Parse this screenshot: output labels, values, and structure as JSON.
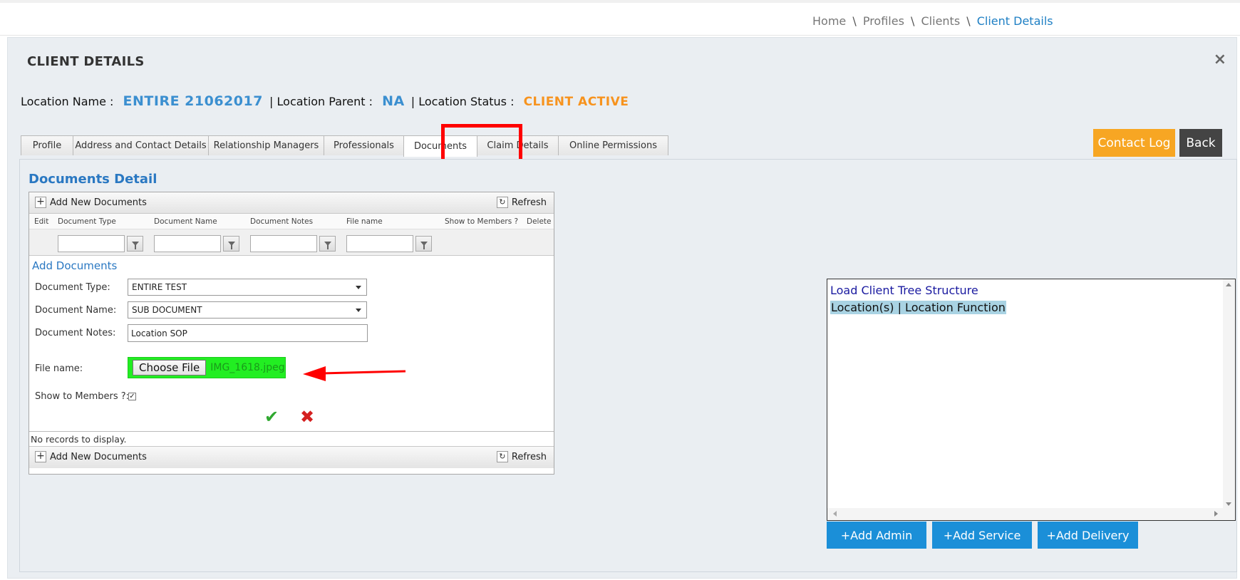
{
  "breadcrumb": {
    "home": "Home",
    "profiles": "Profiles",
    "clients": "Clients",
    "current": "Client Details",
    "separator": "\\"
  },
  "panel": {
    "title": "CLIENT DETAILS",
    "close_symbol": "×"
  },
  "location": {
    "name_label": "Location Name :",
    "name_value": "ENTIRE 21062017",
    "separator": "|",
    "parent_label": "Location Parent :",
    "parent_value": "NA",
    "status_label": "Location Status :",
    "status_value": "CLIENT ACTIVE"
  },
  "tabs": [
    {
      "label": "Profile"
    },
    {
      "label": "Address and Contact Details"
    },
    {
      "label": "Relationship Managers"
    },
    {
      "label": "Professionals"
    },
    {
      "label": "Documents",
      "active": true
    },
    {
      "label": "Claim Details"
    },
    {
      "label": "Online Permissions"
    }
  ],
  "actions": {
    "contact_log": "Contact Log",
    "back": "Back"
  },
  "documents": {
    "section_title": "Documents Detail",
    "toolbar": {
      "add_label": "Add New Documents",
      "add_symbol": "+",
      "refresh_label": "Refresh"
    },
    "columns": [
      "Edit",
      "Document Type",
      "Document Name",
      "Document Notes",
      "File name",
      "Show to Members ?",
      "Delete"
    ],
    "form": {
      "title": "Add Documents",
      "type_label": "Document Type:",
      "type_value": "ENTIRE TEST",
      "name_label": "Document Name:",
      "name_value": "SUB DOCUMENT",
      "notes_label": "Document Notes:",
      "notes_value": "Location SOP",
      "file_label": "File name:",
      "choose_file": "Choose File",
      "file_value": "IMG_1618.jpeg",
      "show_label": "Show to Members ?:",
      "show_checked": true
    },
    "no_records": "No records to display."
  },
  "tree": {
    "title": "Load Client Tree Structure",
    "item": "Location(s) | Location Function"
  },
  "tree_buttons": {
    "add_admin": "+Add Admin",
    "add_service": "+Add Service",
    "add_delivery": "+Add Delivery"
  },
  "colors": {
    "accent_blue": "#2a78c2",
    "status_orange": "#f7931e",
    "contact_log_bg": "#f7a623",
    "back_bg": "#444444",
    "file_highlight": "#22ee22",
    "annotation_red": "#ff0000",
    "tree_button_bg": "#1b8fd8"
  }
}
